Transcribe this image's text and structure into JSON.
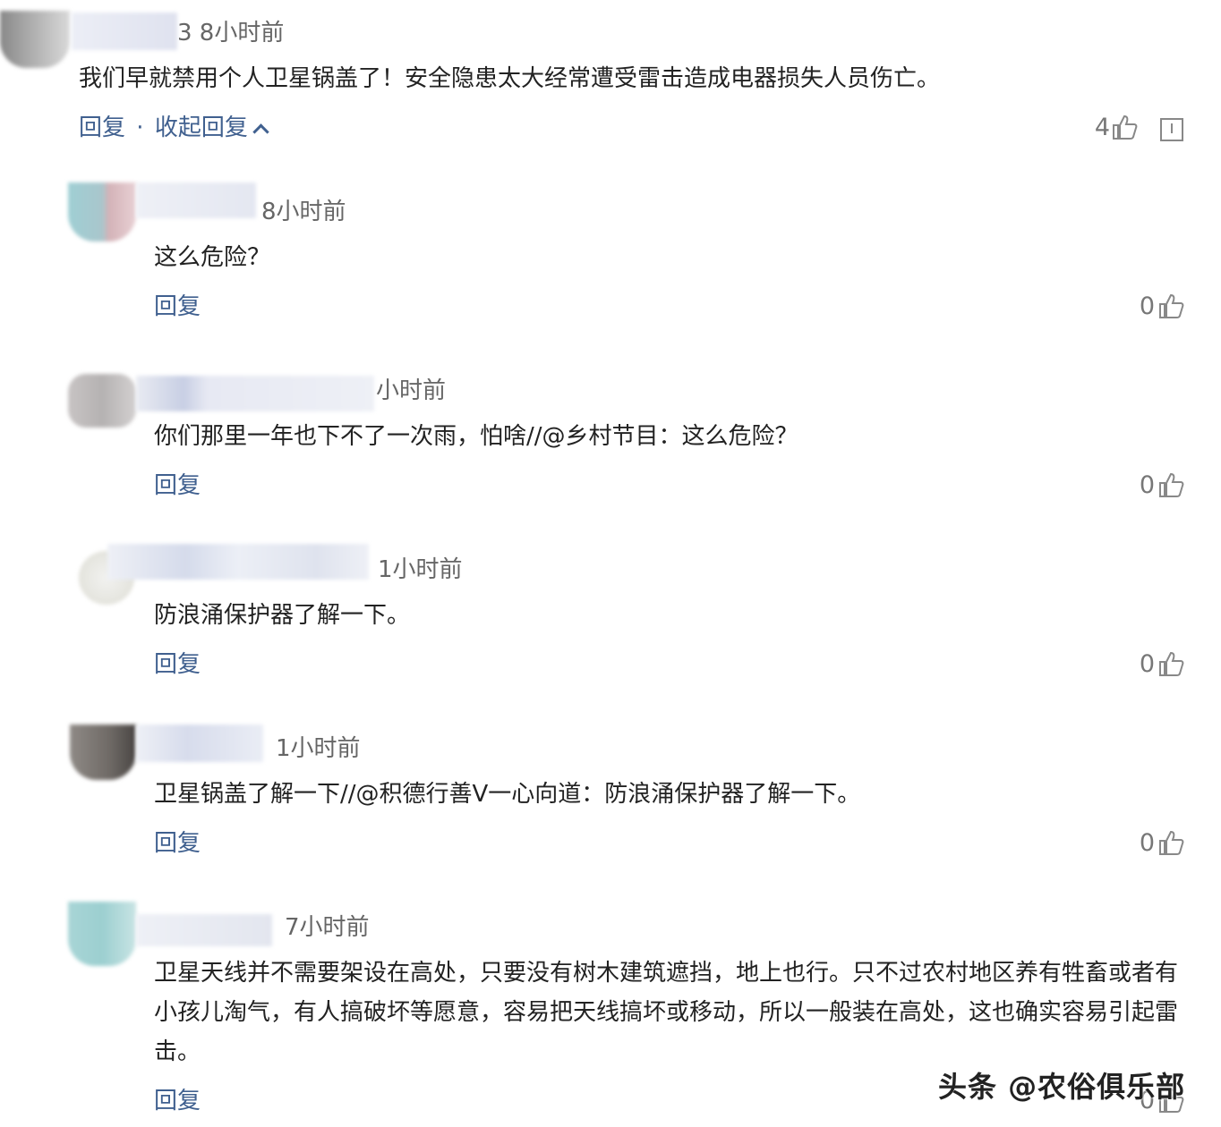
{
  "comments": [
    {
      "time": "3 8小时前",
      "text": "我们早就禁用个人卫星锅盖了！安全隐患太大经常遭受雷击造成电器损失人员伤亡。",
      "reply_label": "回复",
      "separator": "·",
      "collapse_label": "收起回复",
      "likes": "4"
    },
    {
      "time": "8小时前",
      "text": "这么危险？",
      "reply_label": "回复",
      "likes": "0"
    },
    {
      "time": "小时前",
      "text": "你们那里一年也下不了一次雨，怕啥//@乡村节目：这么危险？",
      "reply_label": "回复",
      "likes": "0"
    },
    {
      "time": "1小时前",
      "text": "防浪涌保护器了解一下。",
      "reply_label": "回复",
      "likes": "0"
    },
    {
      "time": "1小时前",
      "text": "卫星锅盖了解一下//@积德行善V一心向道：防浪涌保护器了解一下。",
      "reply_label": "回复",
      "likes": "0"
    },
    {
      "time": "7小时前",
      "text": "卫星天线并不需要架设在高处，只要没有树木建筑遮挡，地上也行。只不过农村地区养有牲畜或者有小孩儿淘气，有人搞破坏等愿意，容易把天线搞坏或移动，所以一般装在高处，这也确实容易引起雷击。",
      "reply_label": "回复",
      "likes": "0"
    }
  ],
  "watermark": "头条 @农俗俱乐部",
  "colors": {
    "link": "#40608f",
    "meta": "#666666",
    "text": "#222222"
  },
  "icons": {
    "like": "thumbs-up-icon",
    "report": "report-icon",
    "collapse": "chevron-up-icon"
  }
}
